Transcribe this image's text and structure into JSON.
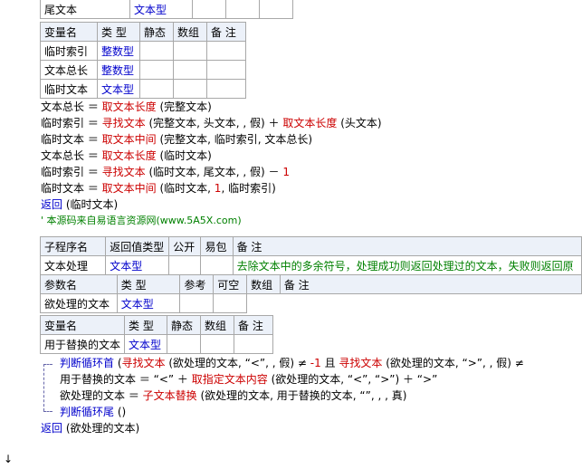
{
  "top_row": {
    "name": "尾文本",
    "type": "文本型"
  },
  "var_table1": {
    "headers": [
      "变量名",
      "类 型",
      "静态",
      "数组",
      "备 注"
    ],
    "rows": [
      {
        "name": "临时索引",
        "type": "整数型"
      },
      {
        "name": "文本总长",
        "type": "整数型"
      },
      {
        "name": "临时文本",
        "type": "文本型"
      }
    ]
  },
  "code1": {
    "l1": {
      "a": "文本总长 ＝ ",
      "f": "取文本长度",
      "b": " (完整文本)"
    },
    "l2": {
      "a": "临时索引 ＝ ",
      "f": "寻找文本",
      "b": " (完整文本, 头文本, , 假) ＋ ",
      "f2": "取文本长度",
      "c": " (头文本)"
    },
    "l3": {
      "a": "临时文本 ＝ ",
      "f": "取文本中间",
      "b": " (完整文本, 临时索引, 文本总长)"
    },
    "l4": {
      "a": "文本总长 ＝ ",
      "f": "取文本长度",
      "b": " (临时文本)"
    },
    "l5": {
      "a": "临时索引 ＝ ",
      "f": "寻找文本",
      "b": " (临时文本, 尾文本, , 假) － ",
      "n": "1"
    },
    "l6": {
      "a": "临时文本 ＝ ",
      "f": "取文本中间",
      "b": " (临时文本, ",
      "n": "1",
      "c": ", 临时索引)"
    },
    "l7": {
      "f": "返回",
      "b": " (临时文本)"
    },
    "l8": {
      "text": "' 本源码来自易语言资源网(www.5A5X.com)"
    }
  },
  "sub_table": {
    "headers": [
      "子程序名",
      "返回值类型",
      "公开",
      "易包",
      "备 注"
    ],
    "name": "文本处理",
    "ret": "文本型",
    "note": "去除文本中的多余符号，处理成功则返回处理过的文本，失败则返回原",
    "param_headers": [
      "参数名",
      "类 型",
      "参考",
      "可空",
      "数组",
      "备 注"
    ],
    "param": {
      "name": "欲处理的文本",
      "type": "文本型"
    }
  },
  "var_table2": {
    "headers": [
      "变量名",
      "类 型",
      "静态",
      "数组",
      "备 注"
    ],
    "row": {
      "name": "用于替换的文本",
      "type": "文本型"
    }
  },
  "code2": {
    "loop": {
      "f": "判断循环首",
      "b": " (",
      "f2": "寻找文本",
      "c": " (欲处理的文本, “<”, , 假) ≠ ",
      "n": "-1",
      "d": " 且 ",
      "f3": "寻找文本",
      "e": " (欲处理的文本, “>”, , 假) ≠"
    },
    "l2": {
      "a": "用于替换的文本 ＝ “<” ＋ ",
      "f": "取指定文本内容",
      "b": " (欲处理的文本, “<”, “>”) ＋ “>”"
    },
    "l3": {
      "a": "欲处理的文本 ＝ ",
      "f": "子文本替换",
      "b": " (欲处理的文本, 用于替换的文本, “”, , , 真)"
    },
    "loop_end": {
      "f": "判断循环尾",
      "b": " ()"
    },
    "ret": {
      "f": "返回",
      "b": " (欲处理的文本)"
    }
  }
}
